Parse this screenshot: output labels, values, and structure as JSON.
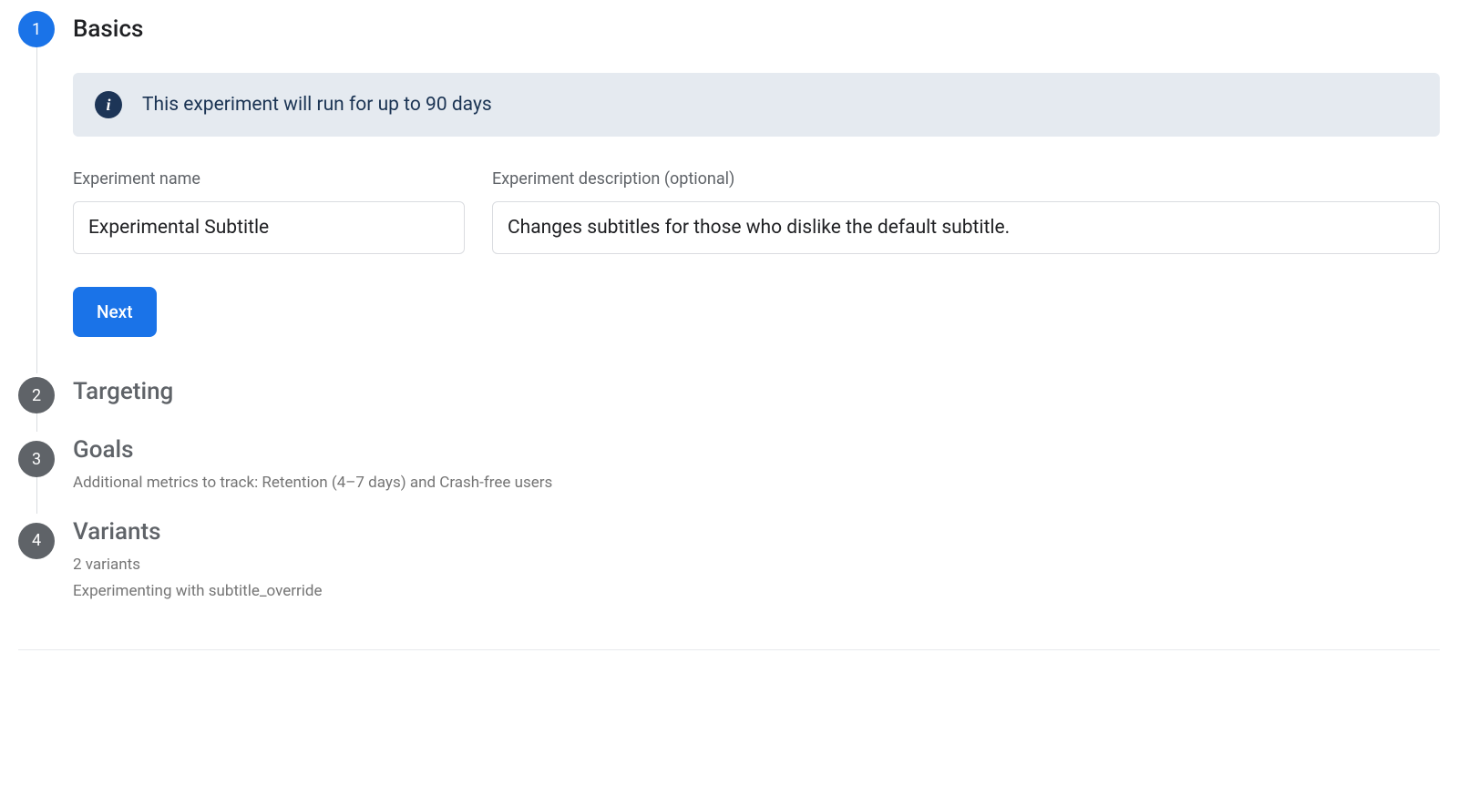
{
  "steps": {
    "basics": {
      "number": "1",
      "title": "Basics",
      "banner_text": "This experiment will run for up to 90 days",
      "name_label": "Experiment name",
      "name_value": "Experimental Subtitle",
      "desc_label": "Experiment description (optional)",
      "desc_value": "Changes subtitles for those who dislike the default subtitle.",
      "next_label": "Next"
    },
    "targeting": {
      "number": "2",
      "title": "Targeting"
    },
    "goals": {
      "number": "3",
      "title": "Goals",
      "subtitle": "Additional metrics to track: Retention (4–7 days) and Crash-free users"
    },
    "variants": {
      "number": "4",
      "title": "Variants",
      "subtitle_1": "2 variants",
      "subtitle_2": "Experimenting with subtitle_override"
    }
  },
  "info_icon_glyph": "i"
}
